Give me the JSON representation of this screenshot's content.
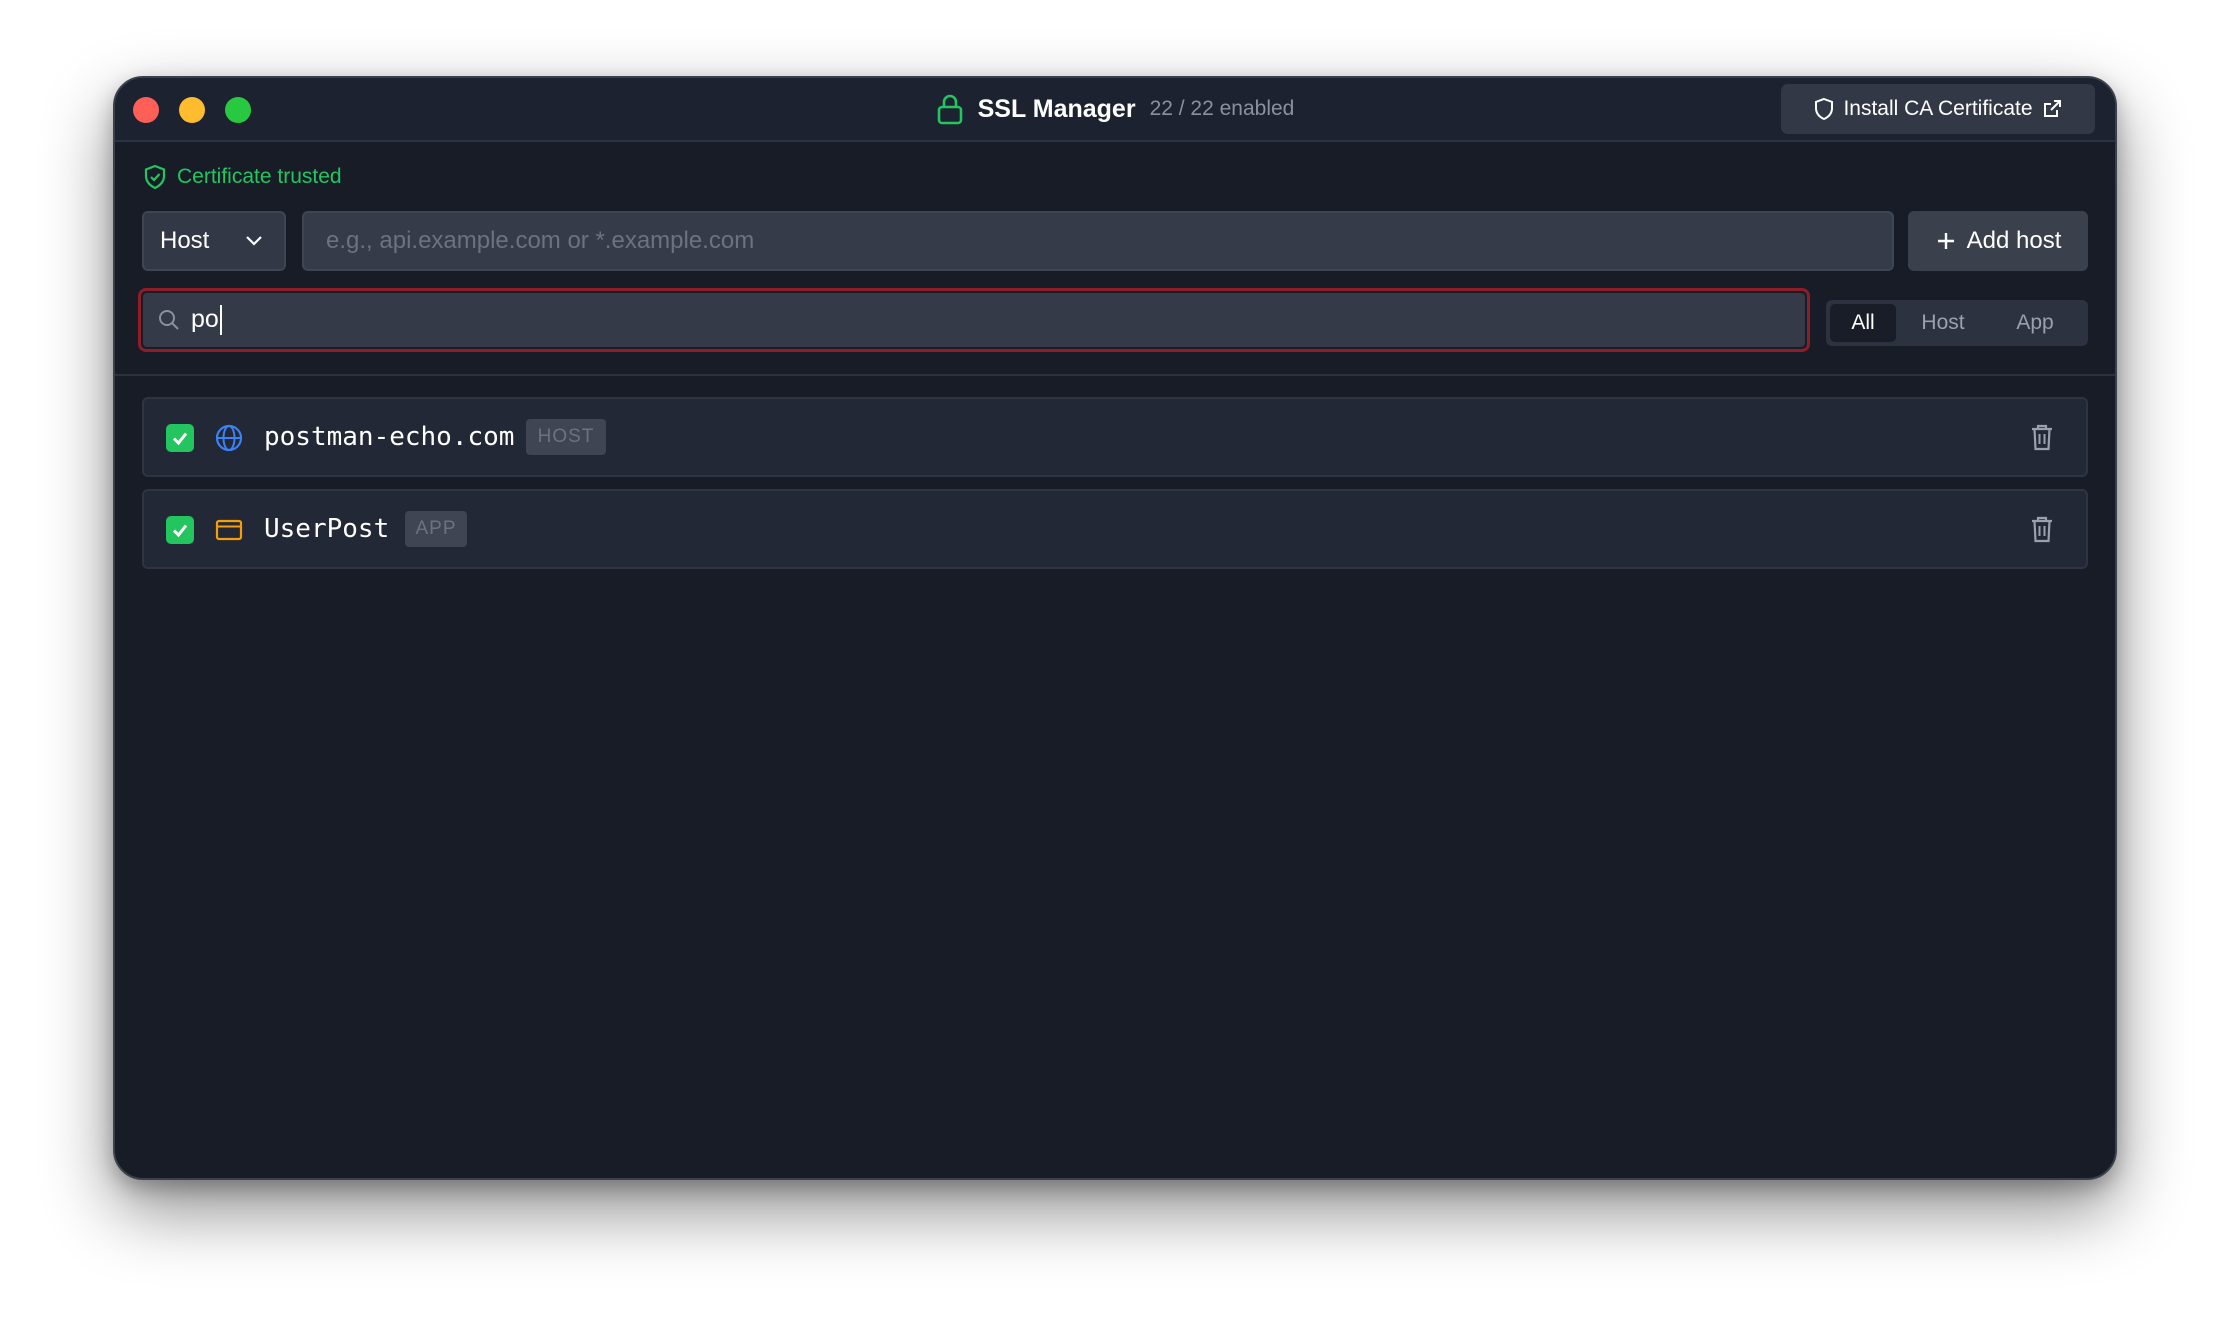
{
  "window": {
    "title": "SSL Manager",
    "enabled_count": "22 / 22 enabled",
    "install_ca_label": "Install CA Certificate"
  },
  "status": {
    "certificate_text": "Certificate trusted",
    "color": "#22c55e"
  },
  "add_form": {
    "type_value": "Host",
    "host_placeholder": "e.g., api.example.com or *.example.com",
    "host_value": "",
    "add_label": "Add host"
  },
  "search": {
    "value": "po"
  },
  "filter": {
    "options": [
      "All",
      "Host",
      "App"
    ],
    "selected": "All"
  },
  "entries": [
    {
      "name": "postman-echo.com",
      "type": "HOST",
      "icon": "globe-icon",
      "enabled": true
    },
    {
      "name": "UserPost",
      "type": "APP",
      "icon": "app-window-icon",
      "enabled": true
    }
  ],
  "colors": {
    "accent_green": "#22c55e",
    "globe_blue": "#3b82f6",
    "app_orange": "#f59e0b",
    "focus_red": "#8e1d28"
  }
}
